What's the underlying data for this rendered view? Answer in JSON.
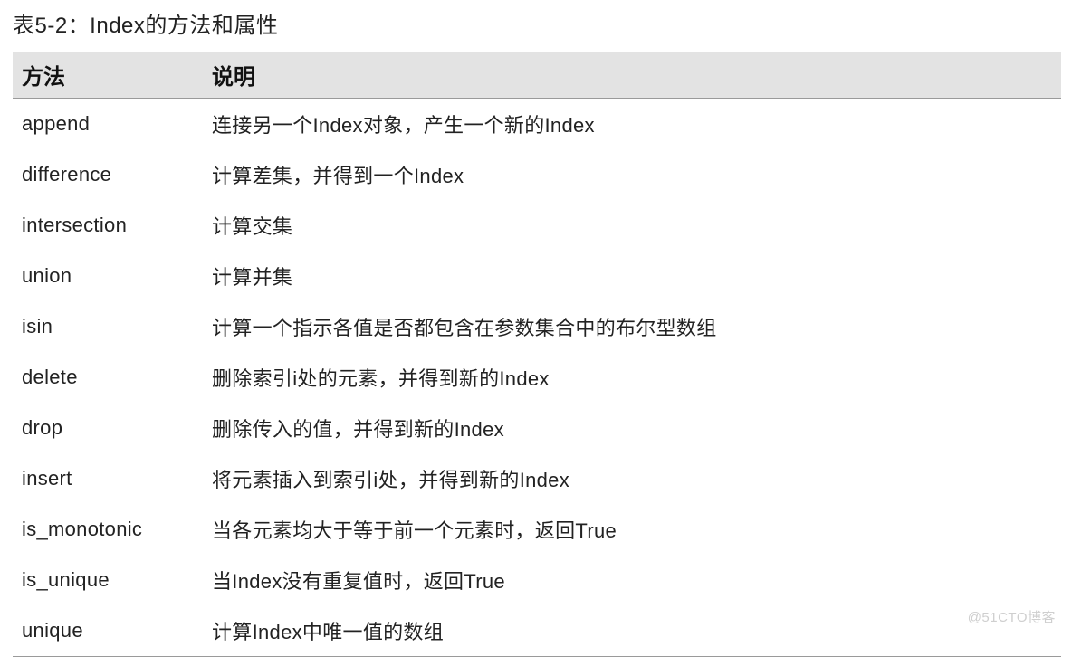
{
  "caption": "表5-2：Index的方法和属性",
  "headers": {
    "method": "方法",
    "description": "说明"
  },
  "rows": [
    {
      "method": "append",
      "description": "连接另一个Index对象，产生一个新的Index"
    },
    {
      "method": "difference",
      "description": "计算差集，并得到一个Index"
    },
    {
      "method": "intersection",
      "description": "计算交集"
    },
    {
      "method": "union",
      "description": "计算并集"
    },
    {
      "method": "isin",
      "description": "计算一个指示各值是否都包含在参数集合中的布尔型数组"
    },
    {
      "method": "delete",
      "description": "删除索引i处的元素，并得到新的Index"
    },
    {
      "method": "drop",
      "description": "删除传入的值，并得到新的Index"
    },
    {
      "method": "insert",
      "description": "将元素插入到索引i处，并得到新的Index"
    },
    {
      "method": "is_monotonic",
      "description": "当各元素均大于等于前一个元素时，返回True"
    },
    {
      "method": "is_unique",
      "description": "当Index没有重复值时，返回True"
    },
    {
      "method": "unique",
      "description": "计算Index中唯一值的数组"
    }
  ],
  "watermark": "@51CTO博客"
}
